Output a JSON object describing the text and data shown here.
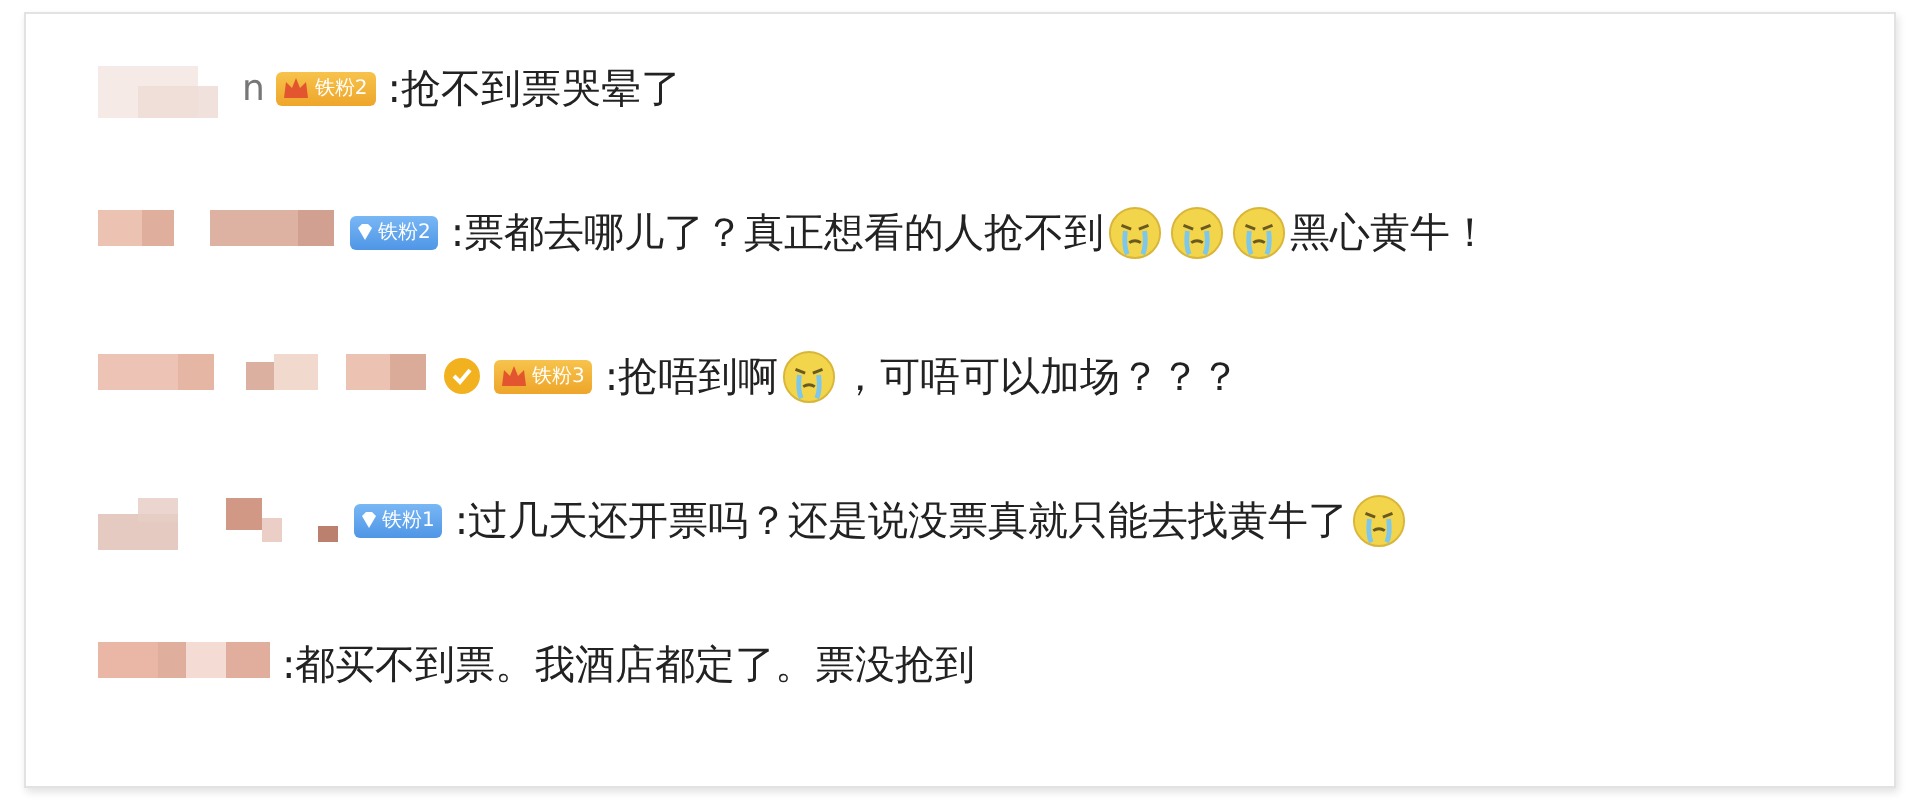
{
  "comments": [
    {
      "name_tail": "n",
      "verified": false,
      "badge": {
        "kind": "gold",
        "text": "铁粉2"
      },
      "content": [
        {
          "kind": "text",
          "text": ":抢不到票哭晕了"
        }
      ]
    },
    {
      "verified": false,
      "badge": {
        "kind": "blue",
        "text": "铁粉2"
      },
      "content": [
        {
          "kind": "text",
          "text": ":票都去哪儿了？真正想看的人抢不到"
        },
        {
          "kind": "emoji"
        },
        {
          "kind": "emoji"
        },
        {
          "kind": "emoji"
        },
        {
          "kind": "text",
          "text": "黑心黄牛！"
        }
      ]
    },
    {
      "verified": true,
      "badge": {
        "kind": "gold",
        "text": "铁粉3"
      },
      "content": [
        {
          "kind": "text",
          "text": ":抢唔到啊"
        },
        {
          "kind": "emoji"
        },
        {
          "kind": "text",
          "text": "，可唔可以加场？？？"
        }
      ]
    },
    {
      "verified": false,
      "badge": {
        "kind": "blue",
        "text": "铁粉1"
      },
      "content": [
        {
          "kind": "text",
          "text": ":过几天还开票吗？还是说没票真就只能去找黄牛了"
        },
        {
          "kind": "emoji"
        }
      ]
    },
    {
      "verified": false,
      "content": [
        {
          "kind": "text",
          "text": ":都买不到票。我酒店都定了。票没抢到"
        }
      ]
    }
  ]
}
